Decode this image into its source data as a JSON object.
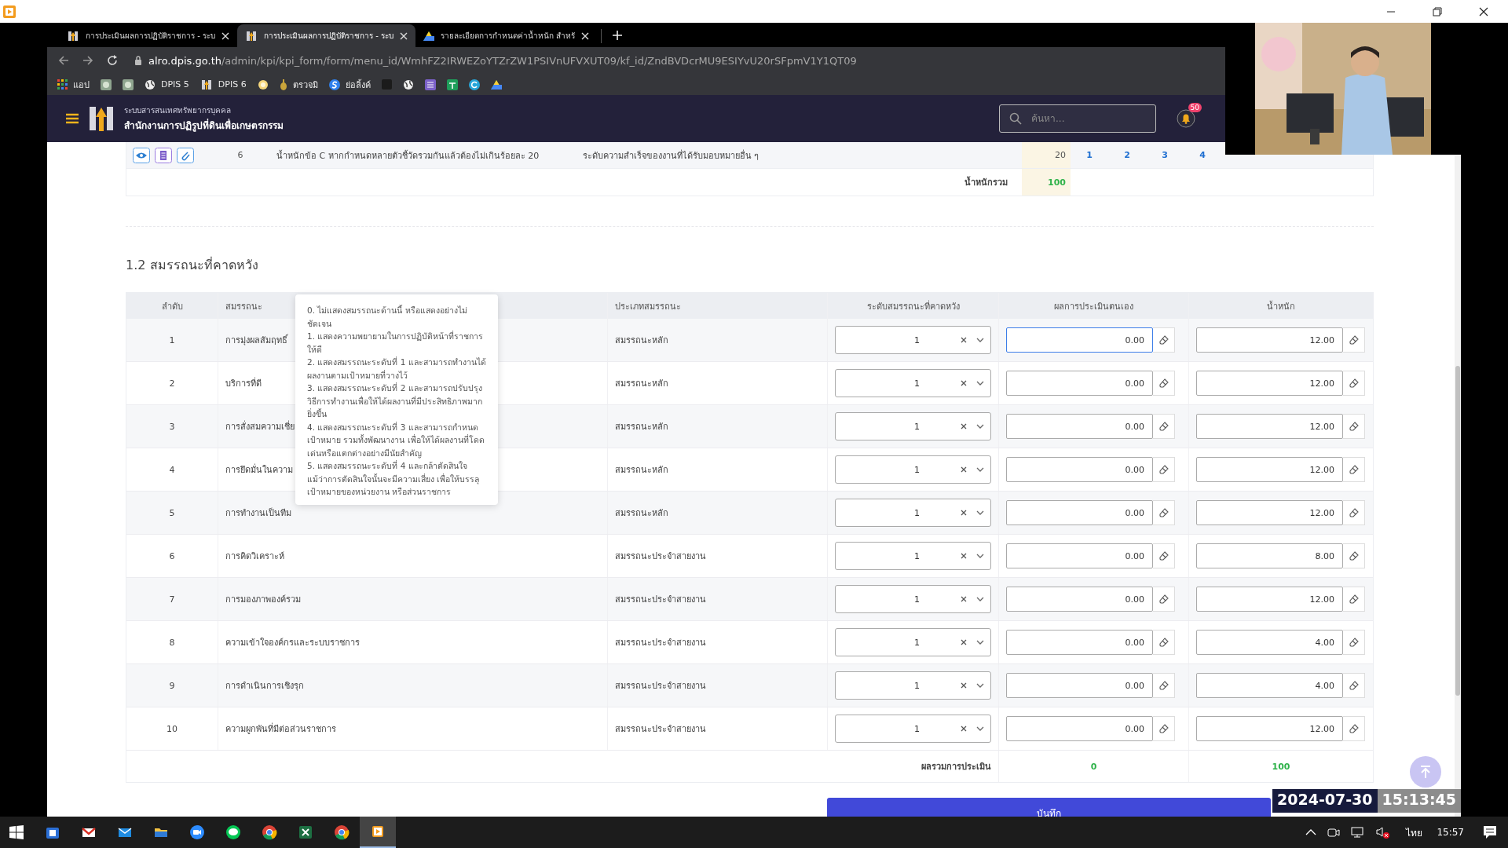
{
  "browser": {
    "tabs": [
      {
        "title": "การประเมินผลการปฏิบัติราชการ - ระบ",
        "selected": false,
        "kind": "logo"
      },
      {
        "title": "การประเมินผลการปฏิบัติราชการ - ระบ",
        "selected": true,
        "kind": "logo"
      },
      {
        "title": "รายละเอียดการกำหนดค่าน้ำหนัก สำหรั",
        "selected": false,
        "kind": "drive"
      }
    ],
    "url_host": "alro.dpis.go.th",
    "url_path": "/admin/kpi/kpi_form/form/menu_id/WmhFZ2IRWEZoYTZrZW1PSIVnUFVXUT09/kf_id/ZndBVDcrMU9ESIYvU20rSFpmV1Y1QT09",
    "bookmarks": [
      {
        "kind": "apps",
        "label": "แอป"
      },
      {
        "kind": "seal"
      },
      {
        "kind": "seal"
      },
      {
        "kind": "globe",
        "label": "DPIS 5"
      },
      {
        "kind": "logo",
        "label": "DPIS 6"
      },
      {
        "kind": "coin"
      },
      {
        "kind": "pin",
        "label": "ตรวจมิ"
      },
      {
        "kind": "s",
        "label": "ย่อลิ้งค์"
      },
      {
        "kind": "dark"
      },
      {
        "kind": "globe"
      },
      {
        "kind": "list"
      },
      {
        "kind": "sheet"
      },
      {
        "kind": "c"
      },
      {
        "kind": "drive"
      }
    ]
  },
  "app_header": {
    "subtitle": "ระบบสารสนเทศทรัพยากรบุคคล",
    "title": "สำนักงานการปฏิรูปที่ดินเพื่อเกษตรกรรม",
    "search": {
      "placeholder": "ค้นหา..."
    },
    "notification_count": "50"
  },
  "kpi_table": {
    "rows": [
      {
        "number": "6",
        "description": "น้ำหนักข้อ C หากกำหนดหลายตัวชี้วัดรวมกันแล้วต้องไม่เกินร้อยละ 20",
        "target": "ระดับความสำเร็จของงานที่ได้รับมอบหมายอื่น ๆ",
        "weight": "20",
        "levels": [
          "1",
          "2",
          "3",
          "4"
        ]
      }
    ],
    "total_label": "น้ำหนักรวม",
    "total": "100"
  },
  "section_title": "1.2 สมรรถนะที่คาดหวัง",
  "competency_table": {
    "columns": [
      "ลำดับ",
      "สมรรถนะ",
      "ประเภทสมรรถนะ",
      "ระดับสมรรถนะที่คาดหวัง",
      "ผลการประเมินตนเอง",
      "น้ำหนัก"
    ],
    "rows": [
      {
        "order": "1",
        "name": "การมุ่งผลสัมฤทธิ์",
        "type": "สมรรถนะหลัก",
        "expected_level": "1",
        "self_score": "0.00",
        "weight": "12.00",
        "focused": true
      },
      {
        "order": "2",
        "name": "บริการที่ดี",
        "type": "สมรรถนะหลัก",
        "expected_level": "1",
        "self_score": "0.00",
        "weight": "12.00",
        "focused": false
      },
      {
        "order": "3",
        "name": "การสั่งสมความเชี่ย",
        "type": "สมรรถนะหลัก",
        "expected_level": "1",
        "self_score": "0.00",
        "weight": "12.00",
        "focused": false
      },
      {
        "order": "4",
        "name": "การยึดมั่นในความ",
        "type": "สมรรถนะหลัก",
        "expected_level": "1",
        "self_score": "0.00",
        "weight": "12.00",
        "focused": false
      },
      {
        "order": "5",
        "name": "การทำงานเป็นทีม",
        "type": "สมรรถนะหลัก",
        "expected_level": "1",
        "self_score": "0.00",
        "weight": "12.00",
        "focused": false
      },
      {
        "order": "6",
        "name": "การคิดวิเคราะห์",
        "type": "สมรรถนะประจำสายงาน",
        "expected_level": "1",
        "self_score": "0.00",
        "weight": "8.00",
        "focused": false
      },
      {
        "order": "7",
        "name": "การมองภาพองค์รวม",
        "type": "สมรรถนะประจำสายงาน",
        "expected_level": "1",
        "self_score": "0.00",
        "weight": "12.00",
        "focused": false
      },
      {
        "order": "8",
        "name": "ความเข้าใจองค์กรและระบบราชการ",
        "type": "สมรรถนะประจำสายงาน",
        "expected_level": "1",
        "self_score": "0.00",
        "weight": "4.00",
        "focused": false
      },
      {
        "order": "9",
        "name": "การดำเนินการเชิงรุก",
        "type": "สมรรถนะประจำสายงาน",
        "expected_level": "1",
        "self_score": "0.00",
        "weight": "4.00",
        "focused": false
      },
      {
        "order": "10",
        "name": "ความผูกพันที่มีต่อส่วนราชการ",
        "type": "สมรรถนะประจำสายงาน",
        "expected_level": "1",
        "self_score": "0.00",
        "weight": "12.00",
        "focused": false
      }
    ],
    "summary_label": "ผลรวมการประเมิน",
    "self_total": "0",
    "weight_total": "100"
  },
  "tooltip": {
    "lines": [
      "0. ไม่แสดงสมรรถนะด้านนี้ หรือแสดงอย่างไม่ชัดเจน",
      "1. แสดงความพยายามในการปฏิบัติหน้าที่ราชการให้ดี",
      "2. แสดงสมรรถนะระดับที่ 1 และสามารถทำงานได้ผลงานตามเป้าหมายที่วางไว้",
      "3. แสดงสมรรถนะระดับที่ 2 และสามารถปรับปรุงวิธีการทำงานเพื่อให้ได้ผลงานที่มีประสิทธิภาพมากยิ่งขึ้น",
      "4. แสดงสมรรถนะระดับที่ 3 และสามารถกำหนดเป้าหมาย รวมทั้งพัฒนางาน เพื่อให้ได้ผลงานที่โดดเด่นหรือแตกต่างอย่างมีนัยสำคัญ",
      "5. แสดงสมรรถนะระดับที่ 4 และกล้าตัดสินใจ แม้ว่าการตัดสินใจนั้นจะมีความเสี่ยง เพื่อให้บรรลุเป้าหมายของหน่วยงาน หรือส่วนราชการ"
    ]
  },
  "save_button": "บันทึก",
  "timestamp": {
    "date": "2024-07-30",
    "time": "15:13:45"
  },
  "taskbar": {
    "apps": [
      {
        "kind": "store",
        "selected": false
      },
      {
        "kind": "mail-m",
        "selected": false
      },
      {
        "kind": "mail",
        "selected": false
      },
      {
        "kind": "folder",
        "selected": false
      },
      {
        "kind": "zoom",
        "selected": false
      },
      {
        "kind": "chat",
        "selected": false
      },
      {
        "kind": "chrome",
        "selected": false
      },
      {
        "kind": "excel",
        "selected": false
      },
      {
        "kind": "chrome",
        "selected": false
      },
      {
        "kind": "player",
        "selected": true
      }
    ],
    "language": "ไทย",
    "clock": "15:57"
  }
}
